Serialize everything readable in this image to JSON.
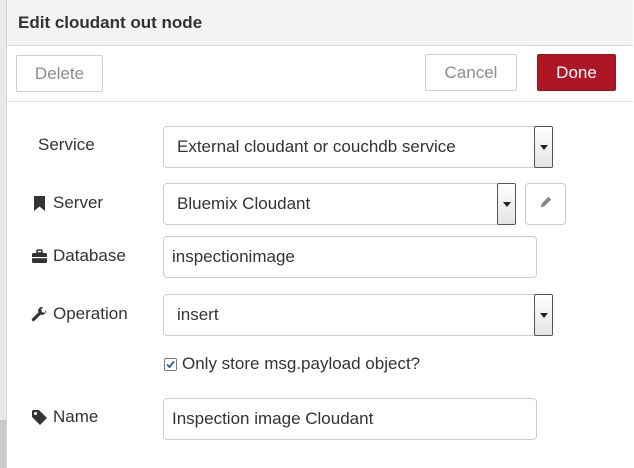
{
  "dialog": {
    "title": "Edit cloudant out node"
  },
  "toolbar": {
    "delete_label": "Delete",
    "cancel_label": "Cancel",
    "done_label": "Done",
    "done_color": "#ad1625"
  },
  "form": {
    "service": {
      "label": "Service",
      "value": "External cloudant or couchdb service"
    },
    "server": {
      "label": "Server",
      "icon": "bookmark-icon",
      "value": "Bluemix Cloudant",
      "edit_icon": "pencil-icon"
    },
    "database": {
      "label": "Database",
      "icon": "briefcase-icon",
      "value": "inspectionimage"
    },
    "operation": {
      "label": "Operation",
      "icon": "wrench-icon",
      "value": "insert"
    },
    "payload_only": {
      "label": "Only store msg.payload object?",
      "checked": true
    },
    "name": {
      "label": "Name",
      "icon": "tag-icon",
      "value": "Inspection image Cloudant"
    }
  }
}
